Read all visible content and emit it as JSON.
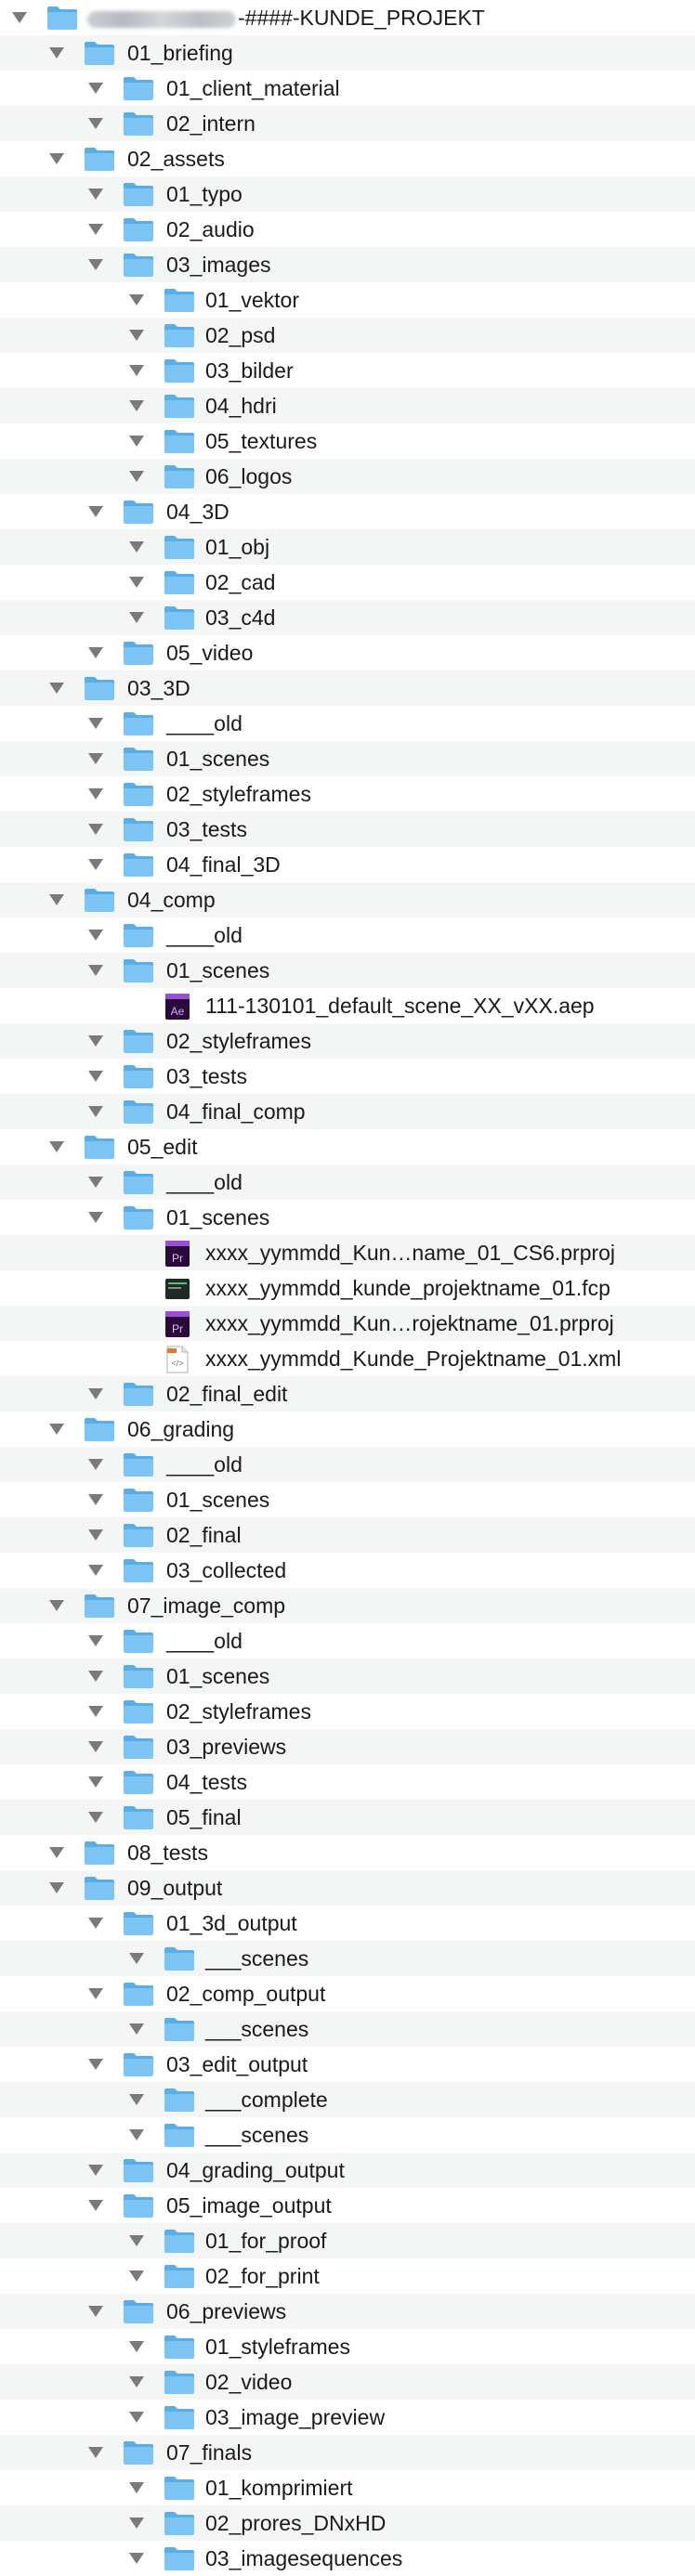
{
  "colors": {
    "folder_front": "#7cc4f4",
    "folder_back": "#5aaee8",
    "stripe": "#f4f5f5",
    "disclosure": "#7a7a7a"
  },
  "root": {
    "suffix": "-####-KUNDE_PROJEKT",
    "redacted_prefix": true
  },
  "rows": [
    {
      "depth": 0,
      "type": "folder",
      "expanded": true,
      "label": "01_briefing"
    },
    {
      "depth": 1,
      "type": "folder",
      "expanded": true,
      "label": "01_client_material"
    },
    {
      "depth": 1,
      "type": "folder",
      "expanded": true,
      "label": "02_intern"
    },
    {
      "depth": 0,
      "type": "folder",
      "expanded": true,
      "label": "02_assets"
    },
    {
      "depth": 1,
      "type": "folder",
      "expanded": true,
      "label": "01_typo"
    },
    {
      "depth": 1,
      "type": "folder",
      "expanded": true,
      "label": "02_audio"
    },
    {
      "depth": 1,
      "type": "folder",
      "expanded": true,
      "label": "03_images"
    },
    {
      "depth": 2,
      "type": "folder",
      "expanded": true,
      "label": "01_vektor"
    },
    {
      "depth": 2,
      "type": "folder",
      "expanded": true,
      "label": "02_psd"
    },
    {
      "depth": 2,
      "type": "folder",
      "expanded": true,
      "label": "03_bilder"
    },
    {
      "depth": 2,
      "type": "folder",
      "expanded": true,
      "label": "04_hdri"
    },
    {
      "depth": 2,
      "type": "folder",
      "expanded": true,
      "label": "05_textures"
    },
    {
      "depth": 2,
      "type": "folder",
      "expanded": true,
      "label": "06_logos"
    },
    {
      "depth": 1,
      "type": "folder",
      "expanded": true,
      "label": "04_3D"
    },
    {
      "depth": 2,
      "type": "folder",
      "expanded": true,
      "label": "01_obj"
    },
    {
      "depth": 2,
      "type": "folder",
      "expanded": true,
      "label": "02_cad"
    },
    {
      "depth": 2,
      "type": "folder",
      "expanded": true,
      "label": "03_c4d"
    },
    {
      "depth": 1,
      "type": "folder",
      "expanded": true,
      "label": "05_video"
    },
    {
      "depth": 0,
      "type": "folder",
      "expanded": true,
      "label": "03_3D"
    },
    {
      "depth": 1,
      "type": "folder",
      "expanded": true,
      "label": "____old"
    },
    {
      "depth": 1,
      "type": "folder",
      "expanded": true,
      "label": "01_scenes"
    },
    {
      "depth": 1,
      "type": "folder",
      "expanded": true,
      "label": "02_styleframes"
    },
    {
      "depth": 1,
      "type": "folder",
      "expanded": true,
      "label": "03_tests"
    },
    {
      "depth": 1,
      "type": "folder",
      "expanded": true,
      "label": "04_final_3D"
    },
    {
      "depth": 0,
      "type": "folder",
      "expanded": true,
      "label": "04_comp"
    },
    {
      "depth": 1,
      "type": "folder",
      "expanded": true,
      "label": "____old"
    },
    {
      "depth": 1,
      "type": "folder",
      "expanded": true,
      "label": "01_scenes"
    },
    {
      "depth": 2,
      "type": "file",
      "icon": "ae",
      "label": "111-130101_default_scene_XX_vXX.aep"
    },
    {
      "depth": 1,
      "type": "folder",
      "expanded": true,
      "label": "02_styleframes"
    },
    {
      "depth": 1,
      "type": "folder",
      "expanded": true,
      "label": "03_tests"
    },
    {
      "depth": 1,
      "type": "folder",
      "expanded": true,
      "label": "04_final_comp"
    },
    {
      "depth": 0,
      "type": "folder",
      "expanded": true,
      "label": "05_edit"
    },
    {
      "depth": 1,
      "type": "folder",
      "expanded": true,
      "label": "____old"
    },
    {
      "depth": 1,
      "type": "folder",
      "expanded": true,
      "label": "01_scenes"
    },
    {
      "depth": 2,
      "type": "file",
      "icon": "pr",
      "label": "xxxx_yymmdd_Kun…name_01_CS6.prproj"
    },
    {
      "depth": 2,
      "type": "file",
      "icon": "fcp",
      "label": "xxxx_yymmdd_kunde_projektname_01.fcp"
    },
    {
      "depth": 2,
      "type": "file",
      "icon": "pr",
      "label": "xxxx_yymmdd_Kun…rojektname_01.prproj"
    },
    {
      "depth": 2,
      "type": "file",
      "icon": "xml",
      "label": "xxxx_yymmdd_Kunde_Projektname_01.xml"
    },
    {
      "depth": 1,
      "type": "folder",
      "expanded": true,
      "label": "02_final_edit"
    },
    {
      "depth": 0,
      "type": "folder",
      "expanded": true,
      "label": "06_grading"
    },
    {
      "depth": 1,
      "type": "folder",
      "expanded": true,
      "label": "____old"
    },
    {
      "depth": 1,
      "type": "folder",
      "expanded": true,
      "label": "01_scenes"
    },
    {
      "depth": 1,
      "type": "folder",
      "expanded": true,
      "label": "02_final"
    },
    {
      "depth": 1,
      "type": "folder",
      "expanded": true,
      "label": "03_collected"
    },
    {
      "depth": 0,
      "type": "folder",
      "expanded": true,
      "label": "07_image_comp"
    },
    {
      "depth": 1,
      "type": "folder",
      "expanded": true,
      "label": "____old"
    },
    {
      "depth": 1,
      "type": "folder",
      "expanded": true,
      "label": "01_scenes"
    },
    {
      "depth": 1,
      "type": "folder",
      "expanded": true,
      "label": "02_styleframes"
    },
    {
      "depth": 1,
      "type": "folder",
      "expanded": true,
      "label": "03_previews"
    },
    {
      "depth": 1,
      "type": "folder",
      "expanded": true,
      "label": "04_tests"
    },
    {
      "depth": 1,
      "type": "folder",
      "expanded": true,
      "label": "05_final"
    },
    {
      "depth": 0,
      "type": "folder",
      "expanded": true,
      "label": "08_tests"
    },
    {
      "depth": 0,
      "type": "folder",
      "expanded": true,
      "label": "09_output"
    },
    {
      "depth": 1,
      "type": "folder",
      "expanded": true,
      "label": "01_3d_output"
    },
    {
      "depth": 2,
      "type": "folder",
      "expanded": true,
      "label": "___scenes"
    },
    {
      "depth": 1,
      "type": "folder",
      "expanded": true,
      "label": "02_comp_output"
    },
    {
      "depth": 2,
      "type": "folder",
      "expanded": true,
      "label": "___scenes"
    },
    {
      "depth": 1,
      "type": "folder",
      "expanded": true,
      "label": "03_edit_output"
    },
    {
      "depth": 2,
      "type": "folder",
      "expanded": true,
      "label": "___complete"
    },
    {
      "depth": 2,
      "type": "folder",
      "expanded": true,
      "label": "___scenes"
    },
    {
      "depth": 1,
      "type": "folder",
      "expanded": true,
      "label": "04_grading_output"
    },
    {
      "depth": 1,
      "type": "folder",
      "expanded": true,
      "label": "05_image_output"
    },
    {
      "depth": 2,
      "type": "folder",
      "expanded": true,
      "label": "01_for_proof"
    },
    {
      "depth": 2,
      "type": "folder",
      "expanded": true,
      "label": "02_for_print"
    },
    {
      "depth": 1,
      "type": "folder",
      "expanded": true,
      "label": "06_previews"
    },
    {
      "depth": 2,
      "type": "folder",
      "expanded": true,
      "label": "01_styleframes"
    },
    {
      "depth": 2,
      "type": "folder",
      "expanded": true,
      "label": "02_video"
    },
    {
      "depth": 2,
      "type": "folder",
      "expanded": true,
      "label": "03_image_preview"
    },
    {
      "depth": 1,
      "type": "folder",
      "expanded": true,
      "label": "07_finals"
    },
    {
      "depth": 2,
      "type": "folder",
      "expanded": true,
      "label": "01_komprimiert"
    },
    {
      "depth": 2,
      "type": "folder",
      "expanded": true,
      "label": "02_prores_DNxHD"
    },
    {
      "depth": 2,
      "type": "folder",
      "expanded": true,
      "label": "03_imagesequences"
    }
  ]
}
